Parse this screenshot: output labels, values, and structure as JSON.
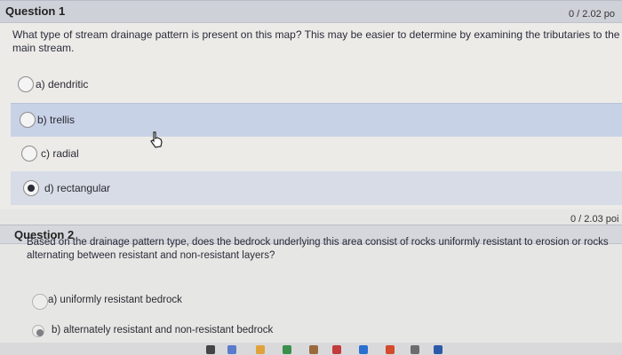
{
  "question1": {
    "title": "Question 1",
    "points": "0 / 2.02 po",
    "text": "What type of stream drainage pattern is present on this map? This may be easier to determine by examining the tributaries to the main stream.",
    "options": [
      {
        "label": "a) dendritic",
        "selected": false
      },
      {
        "label": "b) trellis",
        "selected": false
      },
      {
        "label": "c) radial",
        "selected": false
      },
      {
        "label": "d) rectangular",
        "selected": true
      }
    ]
  },
  "question2": {
    "title": "Question 2",
    "points": "0 / 2.03 poi",
    "text": "Based on the drainage pattern type, does the bedrock underlying this area consist of rocks uniformly resistant to erosion or rocks alternating between resistant and non-resistant layers?",
    "options": [
      {
        "label": "a) uniformly resistant bedrock",
        "selected": false
      },
      {
        "label": "b) alternately resistant and non-resistant bedrock",
        "selected": true
      }
    ]
  },
  "colors": {
    "header_bg": "#cfd1d8",
    "hover_row": "#c8d2e6",
    "selected_row": "#d7dce6",
    "text": "#2a2a33"
  },
  "icons": [
    "hand-pointer-cursor-icon",
    "radio-button-icon",
    "taskbar-app-icon"
  ]
}
